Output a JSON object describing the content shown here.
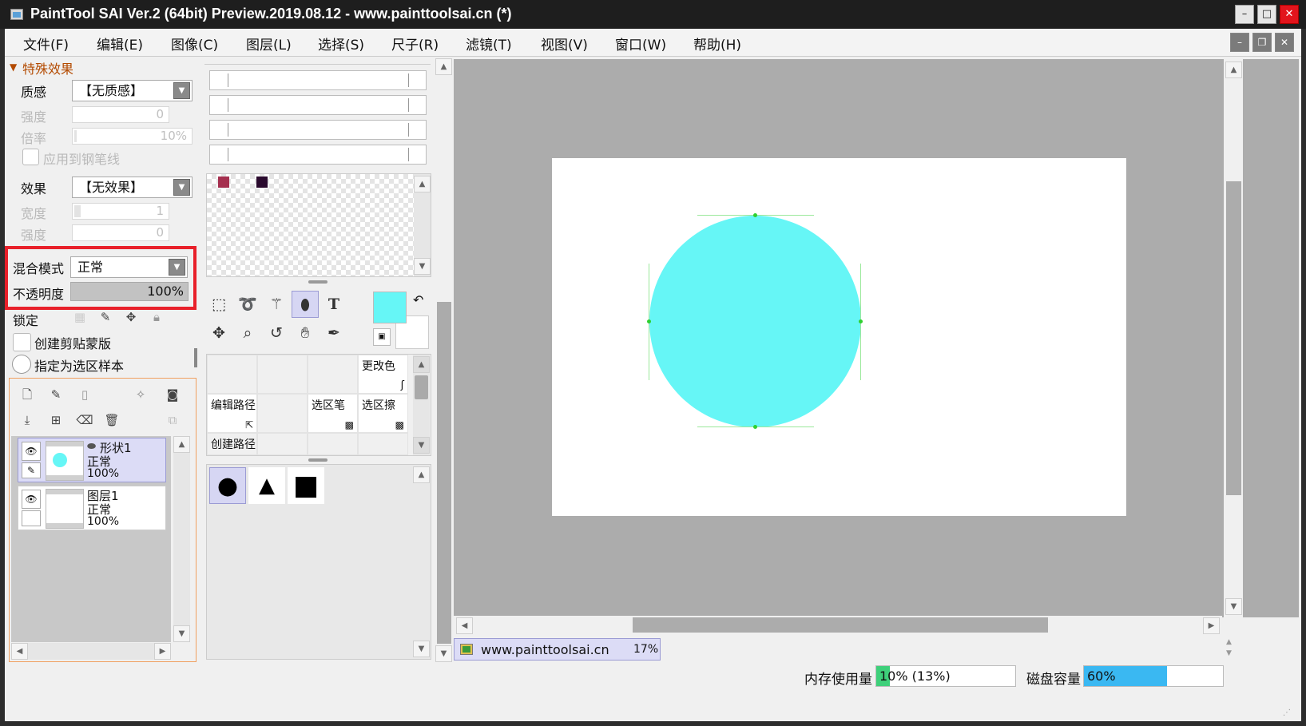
{
  "window": {
    "title": "PaintTool SAI Ver.2 (64bit) Preview.2019.08.12 - www.painttoolsai.cn (*)"
  },
  "menu": [
    "文件(F)",
    "编辑(E)",
    "图像(C)",
    "图层(L)",
    "选择(S)",
    "尺子(R)",
    "滤镜(T)",
    "视图(V)",
    "窗口(W)",
    "帮助(H)"
  ],
  "effects": {
    "section_title": "特殊效果",
    "texture_label": "质感",
    "texture_value": "【无质感】",
    "strength_label": "强度",
    "strength_value": "0",
    "scale_label": "倍率",
    "scale_value": "10%",
    "apply_pen_label": "应用到钢笔线",
    "effect_label": "效果",
    "effect_value": "【无效果】",
    "width_label": "宽度",
    "width_value": "1",
    "strength2_label": "强度",
    "strength2_value": "0"
  },
  "blend": {
    "mode_label": "混合模式",
    "mode_value": "正常",
    "opacity_label": "不透明度",
    "opacity_value": "100%",
    "highlight_color": "#e8202a"
  },
  "lock": {
    "label": "锁定"
  },
  "options": {
    "clip_label": "创建剪贴蒙版",
    "sample_label": "指定为选区样本"
  },
  "layers": [
    {
      "name": "形状1",
      "mode": "正常",
      "opacity": "100%",
      "selected": true
    },
    {
      "name": "图层1",
      "mode": "正常",
      "opacity": "100%",
      "selected": false
    }
  ],
  "palette": {
    "swatches": [
      "#a5304f",
      "#2a0a2e"
    ],
    "primary_color": "#66f6f6",
    "secondary_color": "#ffffff"
  },
  "tool_grid": {
    "change_color": "更改色",
    "edit_path": "编辑路径",
    "sel_pen": "选区笔",
    "sel_eraser": "选区擦",
    "create_path": "创建路径"
  },
  "shapes": [
    "●",
    "▲",
    "■"
  ],
  "canvas": {
    "circle_color": "#66f6f6",
    "doc_name": "www.painttoolsai.cn",
    "zoom": "17%"
  },
  "status": {
    "mem_label": "内存使用量",
    "mem_value": "10% (13%)",
    "mem_fraction": 0.1,
    "disk_label": "磁盘容量",
    "disk_value": "60%",
    "disk_fraction": 0.6
  }
}
